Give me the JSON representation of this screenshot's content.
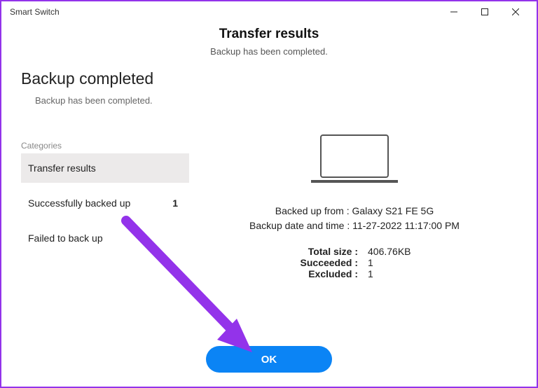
{
  "window": {
    "title": "Smart Switch"
  },
  "header": {
    "title": "Transfer results",
    "subtitle": "Backup has been completed."
  },
  "summary": {
    "title": "Backup completed",
    "subtitle": "Backup has been completed."
  },
  "categories": {
    "label": "Categories",
    "items": [
      {
        "label": "Transfer results",
        "count": "",
        "active": true
      },
      {
        "label": "Successfully backed up",
        "count": "1",
        "active": false
      },
      {
        "label": "Failed to back up",
        "count": "",
        "active": false
      }
    ]
  },
  "details": {
    "backed_up_from_label": "Backed up from : ",
    "backed_up_from_value": "Galaxy S21 FE 5G",
    "backup_datetime_label": "Backup date and time : ",
    "backup_datetime_value": "11-27-2022 11:17:00 PM",
    "stats": {
      "total_size_label": "Total size :",
      "total_size_value": "406.76KB",
      "succeeded_label": "Succeeded :",
      "succeeded_value": "1",
      "excluded_label": "Excluded :",
      "excluded_value": "1"
    }
  },
  "buttons": {
    "ok": "OK"
  },
  "colors": {
    "accent": "#0b84f5",
    "arrow": "#9333ea"
  }
}
